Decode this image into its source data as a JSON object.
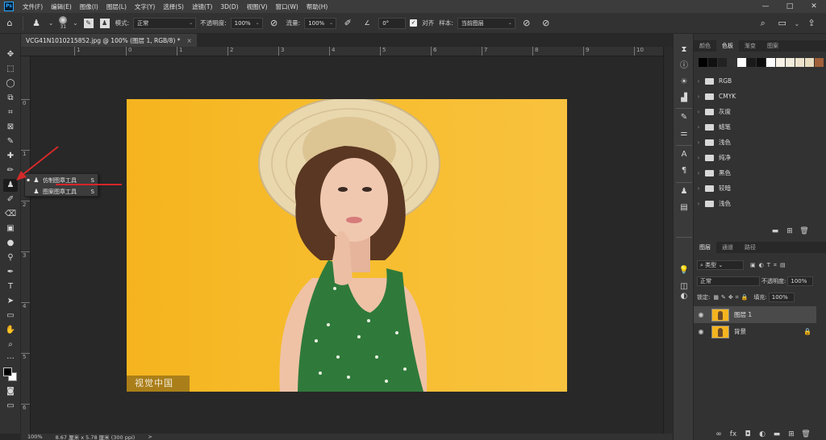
{
  "app": {
    "logo": "Ps"
  },
  "menubar": {
    "items": [
      "文件(F)",
      "编辑(E)",
      "图像(I)",
      "图层(L)",
      "文字(Y)",
      "选择(S)",
      "滤镜(T)",
      "3D(D)",
      "视图(V)",
      "窗口(W)",
      "帮助(H)"
    ],
    "controls": [
      "—",
      "□",
      "✕"
    ]
  },
  "optionsbar": {
    "brush_size": "31",
    "mode_label": "模式:",
    "mode_value": "正常",
    "opacity_label": "不透明度:",
    "opacity_value": "100%",
    "flow_label": "流量:",
    "flow_value": "100%",
    "angle_value": "0°",
    "align_label": "对齐",
    "align_checked": true,
    "sample_label": "样本:",
    "sample_value": "当前图层"
  },
  "document": {
    "tab_title": "VCG41N1010215852.jpg @ 100% (图层 1, RGB/8) *",
    "close": "×"
  },
  "ruler": {
    "h_labels": [
      "1",
      "0",
      "1",
      "2",
      "3",
      "4",
      "5",
      "6",
      "7",
      "8",
      "9",
      "10"
    ],
    "v_labels": [
      "0",
      "1",
      "2",
      "3",
      "4",
      "5",
      "6"
    ]
  },
  "image": {
    "watermark": "视觉中国",
    "description_colors": {
      "background": "#f7bd2e"
    }
  },
  "statusbar": {
    "zoom": "100%",
    "doc_size": "8.67 厘米 x 5.78 厘米 (300 ppi)",
    "arrow": ">"
  },
  "context_menu": {
    "items": [
      {
        "label": "仿制图章工具",
        "shortcut": "S",
        "selected": true,
        "icon": "clone-stamp-icon"
      },
      {
        "label": "图案图章工具",
        "shortcut": "S",
        "selected": false,
        "icon": "pattern-stamp-icon"
      }
    ]
  },
  "swatches_panel": {
    "tabs": [
      "颜色",
      "色板",
      "渐变",
      "图案"
    ],
    "active_tab": "色板",
    "colors": [
      "#000000",
      "#111111",
      "#222222",
      "#333333",
      "#ffffff",
      "#1a1a1a",
      "#0d0d0d",
      "#fefefe",
      "#f7f2e6",
      "#f2ecdc",
      "#ede3cc",
      "#e8dcc0",
      "#a0603a"
    ],
    "groups": [
      "RGB",
      "CMYK",
      "灰度",
      "蜡笔",
      "浅色",
      "纯净",
      "黑色",
      "较暗",
      "浅色"
    ]
  },
  "layers_panel": {
    "tabs": [
      "图层",
      "通道",
      "路径"
    ],
    "active_tab": "图层",
    "filter_kind": "类型",
    "blend_mode": "正常",
    "opacity_label": "不透明度:",
    "opacity_value": "100%",
    "lock_label": "锁定:",
    "fill_label": "填充:",
    "fill_value": "100%",
    "layers": [
      {
        "name": "图层 1",
        "active": true,
        "locked": false
      },
      {
        "name": "背景",
        "active": false,
        "locked": true
      }
    ],
    "footer_icons": [
      "link-icon",
      "fx-icon",
      "mask-icon",
      "adjustment-icon",
      "group-icon",
      "new-layer-icon",
      "delete-icon"
    ],
    "footer_labels": [
      "∞",
      "fx",
      "◘",
      "◐",
      "▬",
      "⊞",
      "🗑"
    ]
  }
}
